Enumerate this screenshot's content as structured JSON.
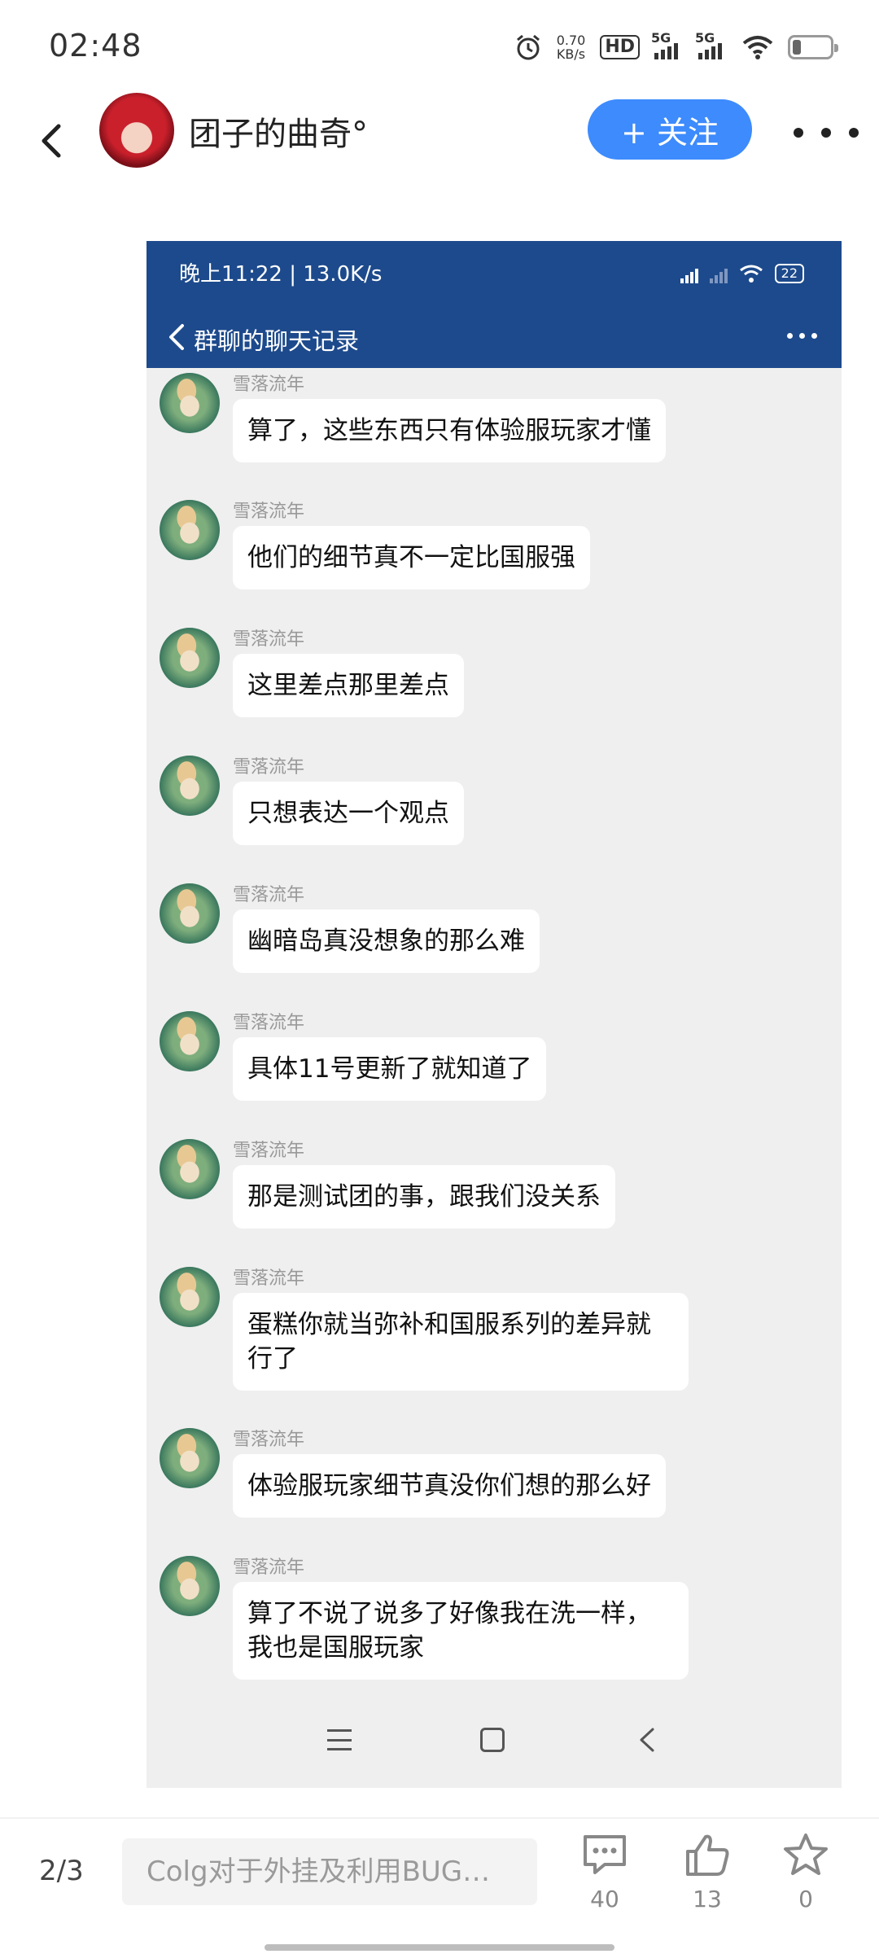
{
  "status_bar": {
    "time": "02:48",
    "net_speed_value": "0.70",
    "net_speed_unit": "KB/s",
    "hd_label": "HD",
    "signal1_label": "5G",
    "signal2_label": "5G"
  },
  "header": {
    "user_name": "团子的曲奇°",
    "follow_label": "+ 关注"
  },
  "screenshot": {
    "status_text": "晚上11:22 | 13.0K/s",
    "battery": "22",
    "title": "群聊的聊天记录",
    "messages": [
      {
        "sender": "雪落流年",
        "text": "算了，这些东西只有体验服玩家才懂"
      },
      {
        "sender": "雪落流年",
        "text": "他们的细节真不一定比国服强"
      },
      {
        "sender": "雪落流年",
        "text": "这里差点那里差点"
      },
      {
        "sender": "雪落流年",
        "text": "只想表达一个观点"
      },
      {
        "sender": "雪落流年",
        "text": "幽暗岛真没想象的那么难"
      },
      {
        "sender": "雪落流年",
        "text": "具体11号更新了就知道了"
      },
      {
        "sender": "雪落流年",
        "text": "那是测试团的事，跟我们没关系"
      },
      {
        "sender": "雪落流年",
        "text": "蛋糕你就当弥补和国服系列的差异就行了"
      },
      {
        "sender": "雪落流年",
        "text": "体验服玩家细节真没你们想的那么好"
      },
      {
        "sender": "雪落流年",
        "text": "算了不说了说多了好像我在洗一样，我也是国服玩家"
      }
    ]
  },
  "bottom_bar": {
    "page_indicator": "2/3",
    "comment_placeholder": "Colg对于外挂及利用BUG…",
    "comments_count": "40",
    "likes_count": "13",
    "favorites_count": "0"
  },
  "colors": {
    "accent": "#3d8bfd",
    "inner_header": "#1d4a8c",
    "chat_background": "#efefef"
  },
  "icons": [
    "back-icon",
    "more-icon",
    "alarm-icon",
    "wifi-icon",
    "battery-icon",
    "comment-icon",
    "like-icon",
    "star-icon"
  ]
}
